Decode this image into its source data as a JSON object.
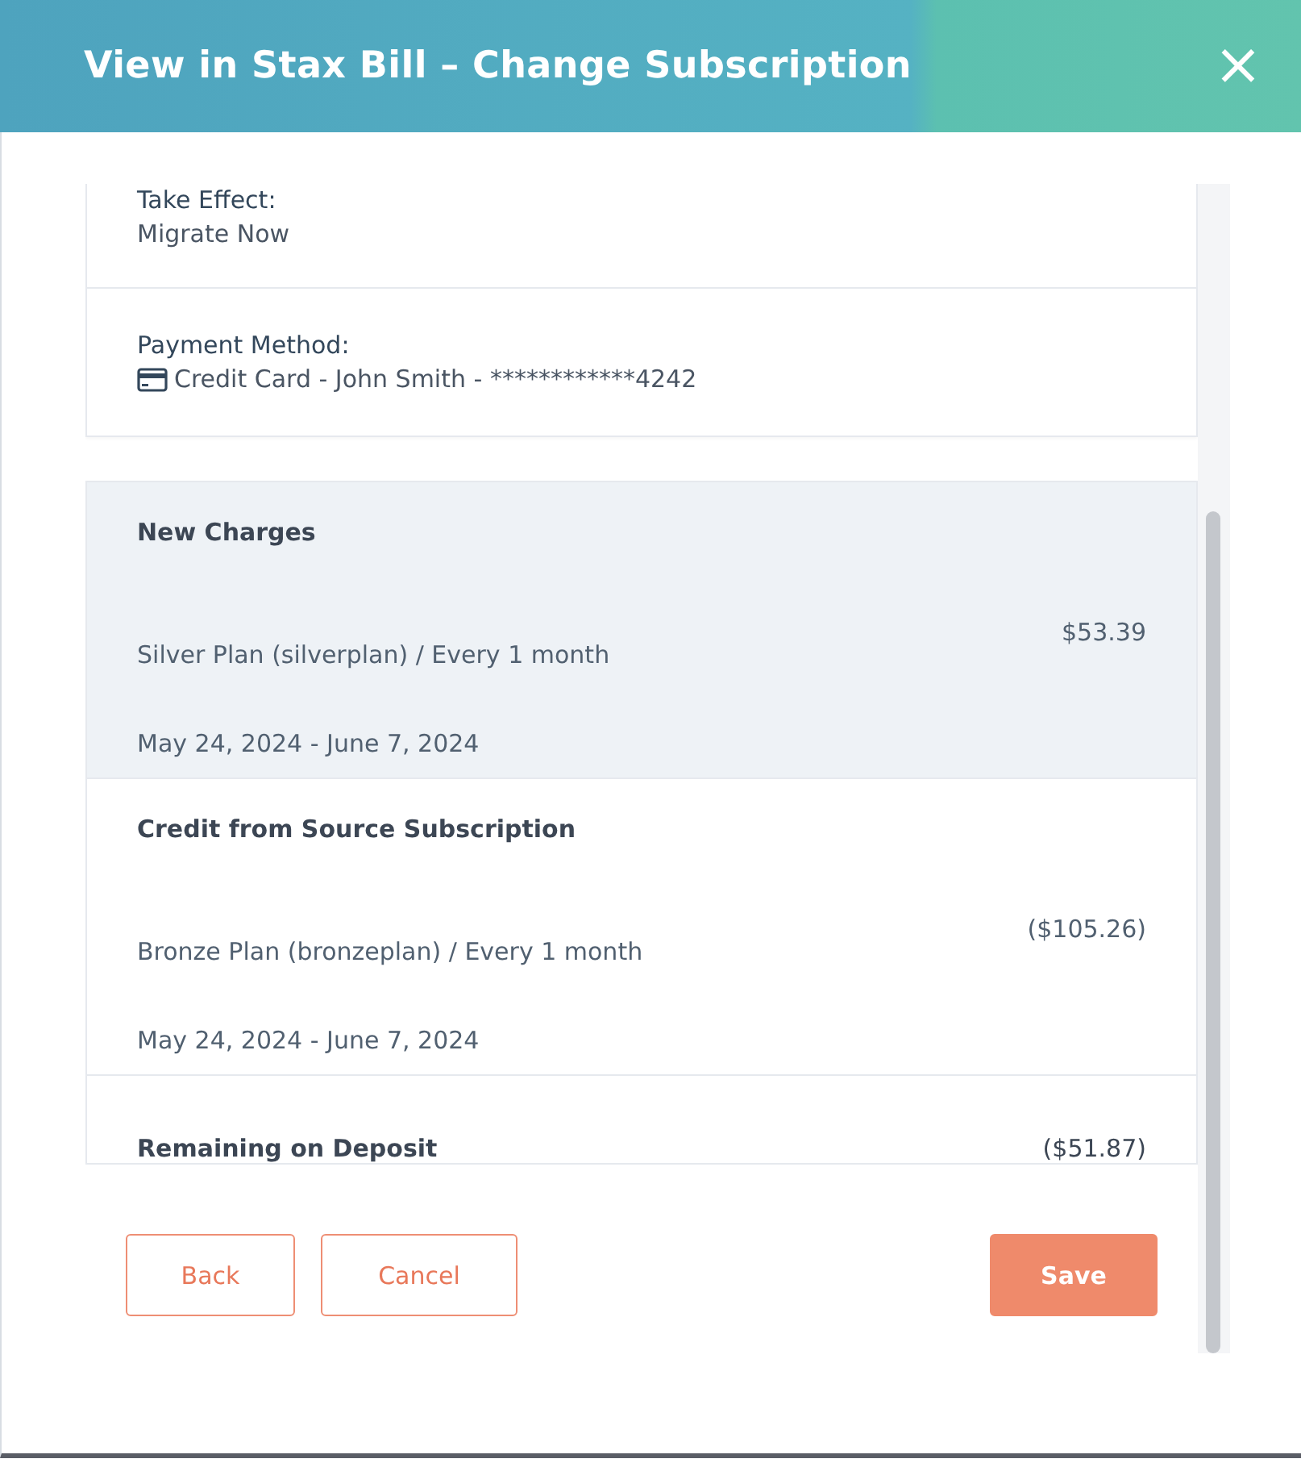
{
  "window": {
    "title": "View in Stax Bill – Change Subscription",
    "close_icon": "×"
  },
  "details": [
    {
      "label": "Take Effect:",
      "value": "Migrate Now",
      "kind": "text"
    },
    {
      "label": "Payment Method:",
      "value": "Credit Card - John Smith - ************4242",
      "kind": "card"
    }
  ],
  "charges": [
    {
      "title": "New Charges",
      "plan": "Silver Plan (silverplan) / Every 1 month",
      "period": "May 24, 2024 - June 7, 2024",
      "amount": "$53.39",
      "hovered": true
    },
    {
      "title": "Credit from Source Subscription",
      "plan": "Bronze Plan (bronzeplan) / Every 1 month",
      "period": "May 24, 2024 - June 7, 2024",
      "amount": "($105.26)",
      "hovered": false
    }
  ],
  "remaining": {
    "label": "Remaining on Deposit",
    "amount": "($51.87)"
  },
  "buttons": [
    {
      "label": "Back",
      "kind": "secondary"
    },
    {
      "label": "Cancel",
      "kind": "secondary"
    },
    {
      "label": "Save",
      "kind": "primary"
    }
  ]
}
